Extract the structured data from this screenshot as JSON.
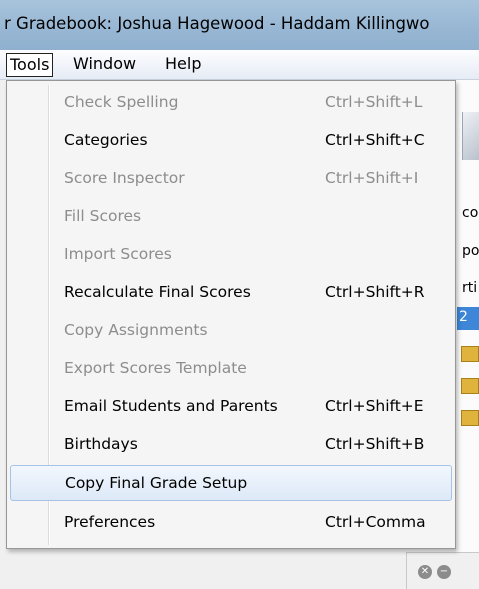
{
  "window": {
    "title": "r Gradebook: Joshua Hagewood - Haddam Killingwo"
  },
  "menubar": {
    "items": [
      {
        "label": "Tools",
        "active": true
      },
      {
        "label": "Window",
        "active": false
      },
      {
        "label": "Help",
        "active": false
      }
    ]
  },
  "tools_menu": {
    "items": [
      {
        "label": "Check Spelling",
        "shortcut": "Ctrl+Shift+L",
        "enabled": false
      },
      {
        "label": "Categories",
        "shortcut": "Ctrl+Shift+C",
        "enabled": true
      },
      {
        "label": "Score Inspector",
        "shortcut": "Ctrl+Shift+I",
        "enabled": false
      },
      {
        "label": "Fill Scores",
        "shortcut": "",
        "enabled": false
      },
      {
        "label": "Import Scores",
        "shortcut": "",
        "enabled": false
      },
      {
        "label": "Recalculate Final Scores",
        "shortcut": "Ctrl+Shift+R",
        "enabled": true
      },
      {
        "label": "Copy Assignments",
        "shortcut": "",
        "enabled": false
      },
      {
        "label": "Export Scores Template",
        "shortcut": "",
        "enabled": false
      },
      {
        "label": "Email Students and Parents",
        "shortcut": "Ctrl+Shift+E",
        "enabled": true
      },
      {
        "label": "Birthdays",
        "shortcut": "Ctrl+Shift+B",
        "enabled": true
      },
      {
        "label": "Copy Final Grade Setup",
        "shortcut": "",
        "enabled": true,
        "highlighted": true
      },
      {
        "label": "Preferences",
        "shortcut": "Ctrl+Comma",
        "enabled": true
      }
    ]
  },
  "background": {
    "fragments": [
      "co",
      "po",
      "rti",
      "2"
    ]
  },
  "colors": {
    "selection": "#3d86d8",
    "disabled_text": "#8d8d8d",
    "titlebar": "#97b6d3"
  }
}
